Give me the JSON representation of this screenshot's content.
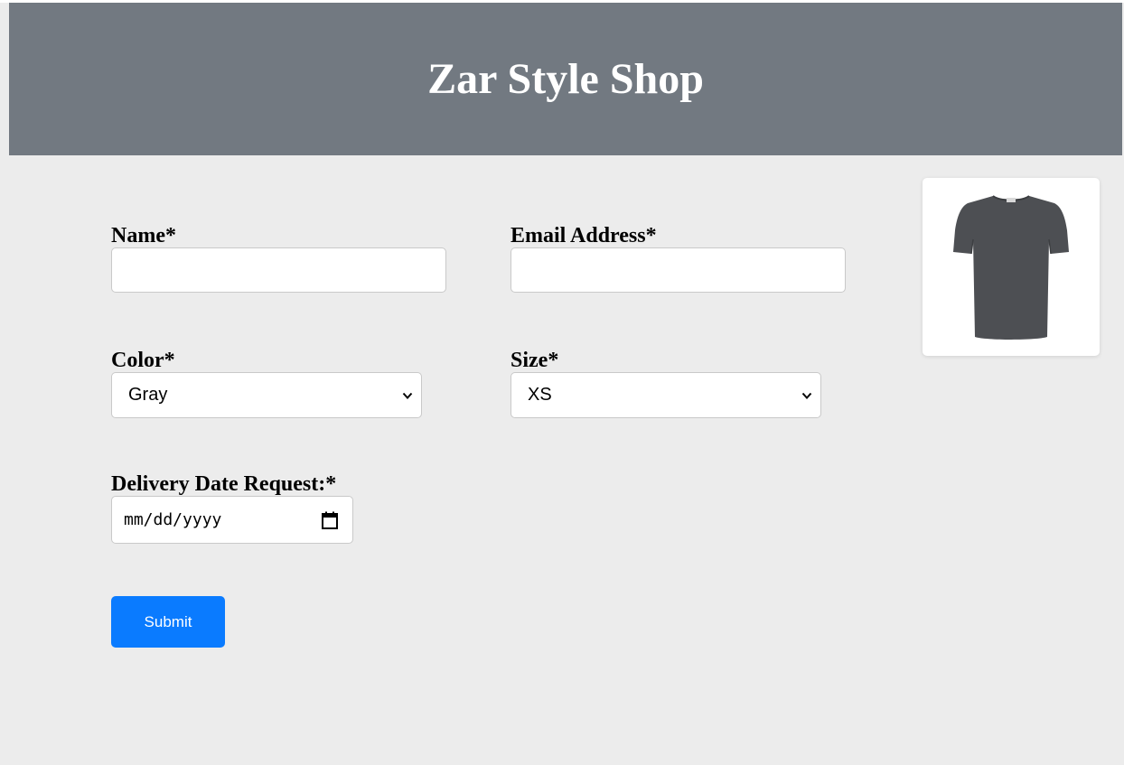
{
  "header": {
    "title": "Zar Style Shop"
  },
  "form": {
    "name": {
      "label": "Name*",
      "value": ""
    },
    "email": {
      "label": "Email Address*",
      "value": ""
    },
    "color": {
      "label": "Color*",
      "selected": "Gray"
    },
    "size": {
      "label": "Size*",
      "selected": "XS"
    },
    "delivery_date": {
      "label": "Delivery Date Request:*",
      "placeholder": "mm/dd/yyyy"
    },
    "submit_label": "Submit"
  },
  "product": {
    "image": "t-shirt-icon",
    "shirt_color": "#4d4f53"
  },
  "colors": {
    "header_bg": "#727981",
    "page_bg": "#ececec",
    "accent": "#0a7bff"
  }
}
